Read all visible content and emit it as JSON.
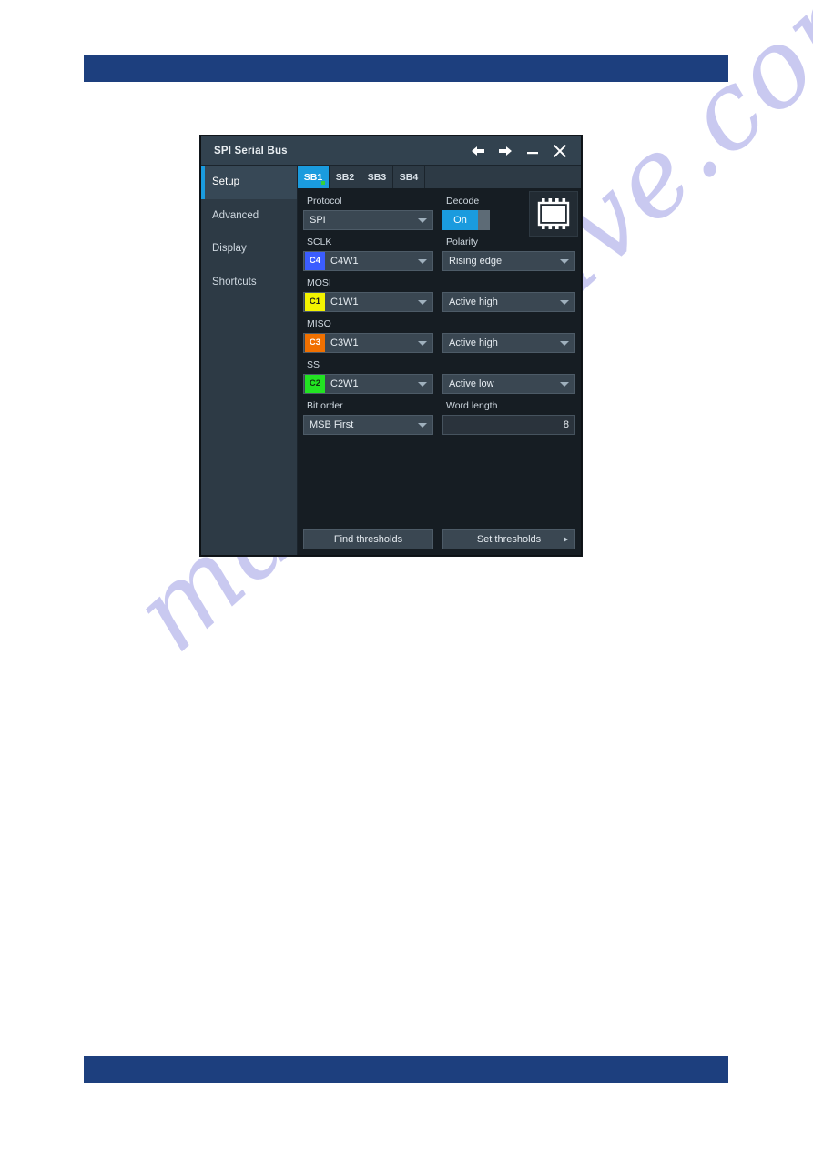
{
  "page": {
    "header_band_color": "#1d3f7e",
    "watermark_text": "manualshive.com",
    "watermark_color": "#a9a9e8"
  },
  "dialog": {
    "title": "SPI Serial Bus",
    "titlebar_buttons": [
      {
        "name": "back-arrow-icon",
        "label": "←"
      },
      {
        "name": "forward-arrow-icon",
        "label": "→"
      },
      {
        "name": "minimize-icon",
        "label": "—"
      },
      {
        "name": "close-icon",
        "label": "✕"
      }
    ],
    "sidebar": {
      "items": [
        {
          "label": "Setup",
          "active": true
        },
        {
          "label": "Advanced",
          "active": false
        },
        {
          "label": "Display",
          "active": false
        },
        {
          "label": "Shortcuts",
          "active": false
        }
      ]
    },
    "tabs": [
      {
        "label": "SB1",
        "active": true,
        "indicator": "green"
      },
      {
        "label": "SB2",
        "active": false
      },
      {
        "label": "SB3",
        "active": false
      },
      {
        "label": "SB4",
        "active": false
      }
    ],
    "setup": {
      "protocol": {
        "label": "Protocol",
        "value": "SPI"
      },
      "decode": {
        "label": "Decode",
        "value": "On",
        "chip_icon": "chip-ic-icon"
      },
      "sclk": {
        "label": "SCLK",
        "channel_badge": "C4",
        "channel_badge_color": "#3b5dff",
        "source": "C4W1",
        "right_label": "Polarity",
        "right_value": "Rising edge"
      },
      "mosi": {
        "label": "MOSI",
        "channel_badge": "C1",
        "channel_badge_color": "#f3f300",
        "source": "C1W1",
        "right_value": "Active high"
      },
      "miso": {
        "label": "MISO",
        "channel_badge": "C3",
        "channel_badge_color": "#f07000",
        "source": "C3W1",
        "right_value": "Active high"
      },
      "ss": {
        "label": "SS",
        "channel_badge": "C2",
        "channel_badge_color": "#22e322",
        "source": "C2W1",
        "right_value": "Active low"
      },
      "bit_order": {
        "label": "Bit order",
        "value": "MSB First"
      },
      "word_length": {
        "label": "Word length",
        "value": "8"
      },
      "find_thresholds_label": "Find thresholds",
      "set_thresholds_label": "Set thresholds"
    }
  }
}
